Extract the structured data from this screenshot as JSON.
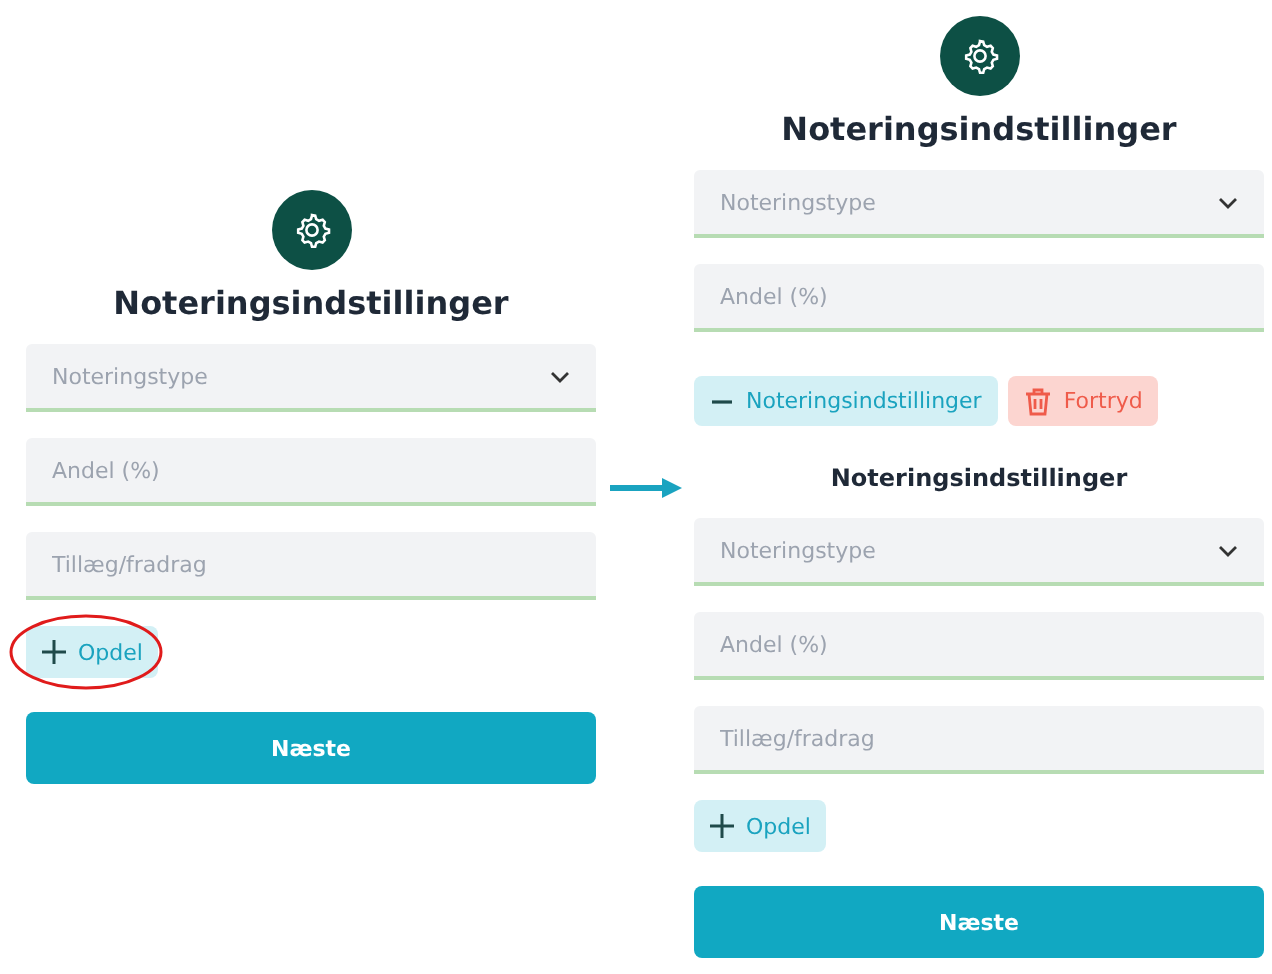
{
  "panels": [
    {
      "items": [
        {
          "kind": "icon"
        },
        {
          "kind": "heading",
          "text": "Noteringsindstillinger"
        },
        {
          "kind": "select",
          "placeholder": "Noteringstype"
        },
        {
          "kind": "input",
          "placeholder": "Andel (%)"
        },
        {
          "kind": "input",
          "placeholder": "Tillæg/fradrag"
        },
        {
          "kind": "add",
          "label": "Opdel",
          "highlighted": true
        },
        {
          "kind": "primary",
          "label": "Næste"
        }
      ]
    },
    {
      "items": [
        {
          "kind": "icon"
        },
        {
          "kind": "heading",
          "text": "Noteringsindstillinger"
        },
        {
          "kind": "select",
          "placeholder": "Noteringstype"
        },
        {
          "kind": "input",
          "placeholder": "Andel (%)"
        },
        {
          "kind": "actions",
          "buttons": [
            {
              "kind": "collapse",
              "label": "Noteringsindstillinger"
            },
            {
              "kind": "delete",
              "label": "Fortryd"
            }
          ]
        },
        {
          "kind": "subheading",
          "text": "Noteringsindstillinger"
        },
        {
          "kind": "select",
          "placeholder": "Noteringstype"
        },
        {
          "kind": "input",
          "placeholder": "Andel (%)"
        },
        {
          "kind": "input",
          "placeholder": "Tillæg/fradrag"
        },
        {
          "kind": "add",
          "label": "Opdel",
          "highlighted": false
        },
        {
          "kind": "primary",
          "label": "Næste"
        }
      ]
    }
  ]
}
